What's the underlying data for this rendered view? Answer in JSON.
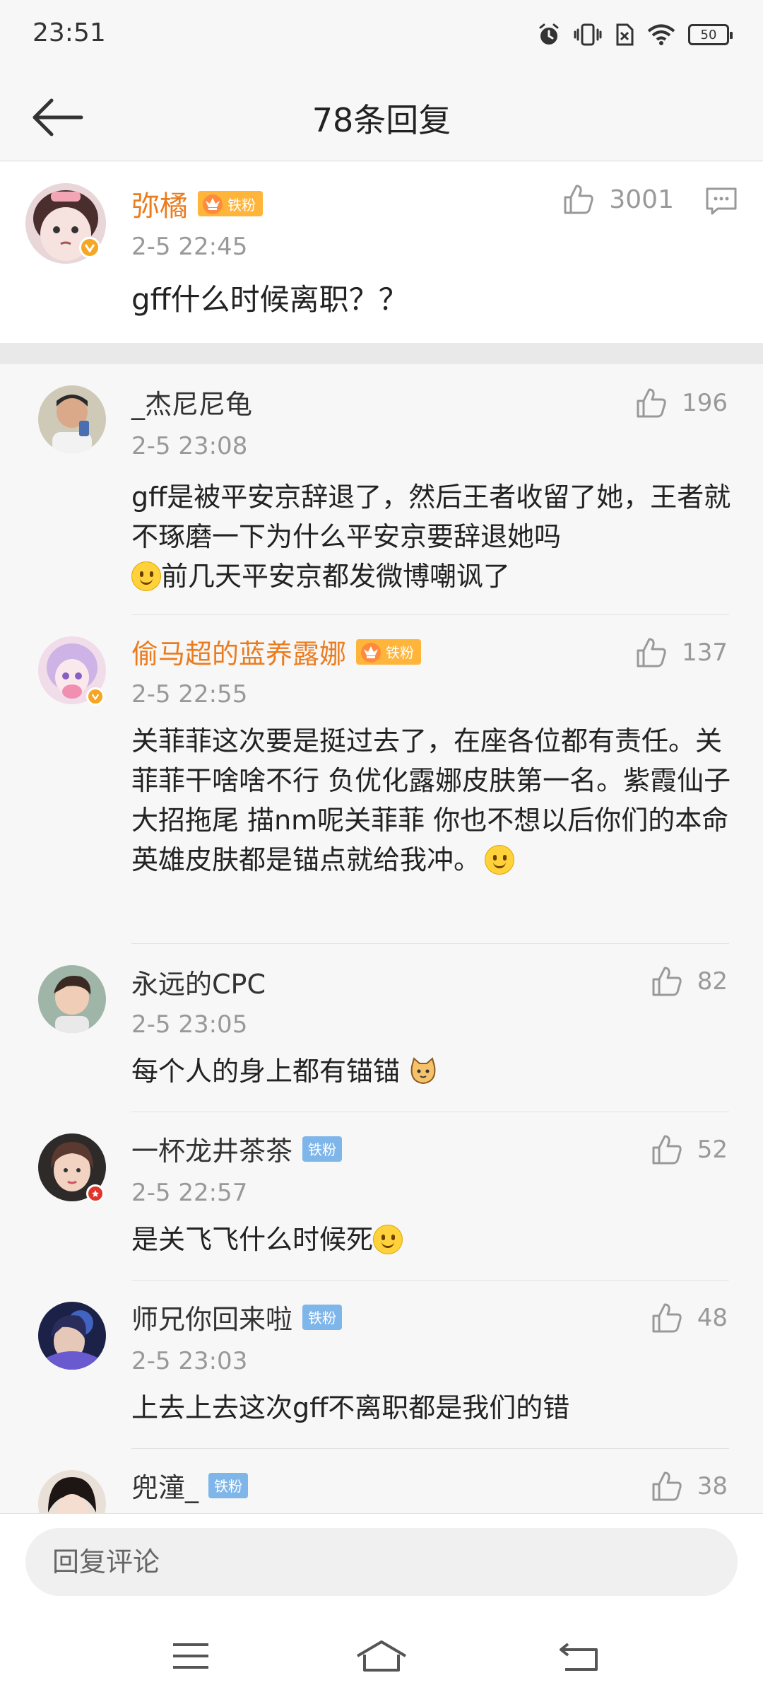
{
  "status_bar": {
    "time": "23:51",
    "battery": "50",
    "icons": [
      "alarm-icon",
      "vibrate-icon",
      "sim-off-icon",
      "wifi-icon",
      "battery-icon"
    ]
  },
  "header": {
    "title": "78条回复",
    "back_icon": "arrow-left-icon"
  },
  "main_comment": {
    "name": "弥橘",
    "badge": "铁粉",
    "time": "2-5 22:45",
    "likes": "3001",
    "content": "gff什么时候离职？？"
  },
  "replies": [
    {
      "name": "_杰尼尼龟",
      "time": "2-5 23:08",
      "likes": "196",
      "content": "gff是被平安京辞退了，然后王者收留了她，王者就不琢磨一下为什么平安京要辞退她吗",
      "content_tail": "前几天平安京都发微博嘲讽了"
    },
    {
      "name": "偷马超的蓝养露娜",
      "badge": "铁粉",
      "time": "2-5 22:55",
      "likes": "137",
      "content": "关菲菲这次要是挺过去了，在座各位都有责任。关菲菲干啥啥不行 负优化露娜皮肤第一名。紫霞仙子大招拖尾 描nm呢关菲菲 你也不想以后你们的本命英雄皮肤都是锚点就给我冲。"
    },
    {
      "name": "永远的CPC",
      "time": "2-5 23:05",
      "likes": "82",
      "content": "每个人的身上都有锚锚"
    },
    {
      "name": "一杯龙井茶茶",
      "badge": "铁粉",
      "time": "2-5 22:57",
      "likes": "52",
      "content": "是关飞飞什么时候死"
    },
    {
      "name": "师兄你回来啦",
      "badge": "铁粉",
      "time": "2-5 23:03",
      "likes": "48",
      "content": "上去上去这次gff不离职都是我们的错"
    },
    {
      "name": "兜潼_",
      "badge": "铁粉",
      "likes": "38"
    }
  ],
  "bottom": {
    "reply_placeholder": "回复评论"
  },
  "colors": {
    "vip_name": "#eb7c1e",
    "fan_badge_gold": "#ffb43a",
    "fan_badge_blue": "#7fb6ea",
    "verified_badge": "#f5a623"
  }
}
